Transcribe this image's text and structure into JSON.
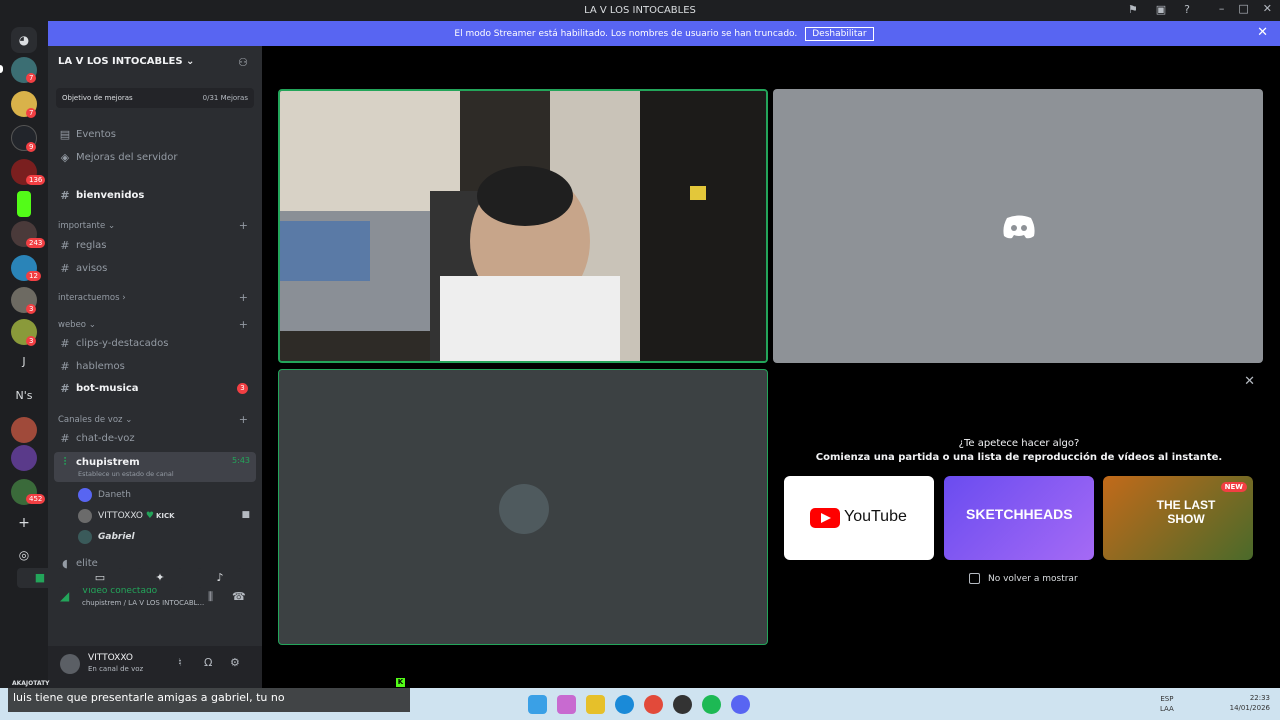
{
  "window": {
    "title": "LA V LOS INTOCABLES"
  },
  "streamer_bar": {
    "text": "El modo Streamer está habilitado. Los nombres de usuario se han truncado.",
    "button": "Deshabilitar"
  },
  "rail": {
    "badges": [
      "7",
      "7",
      "9",
      "136",
      "243",
      "12",
      "3",
      "3",
      "452"
    ],
    "letters": [
      "J",
      "N's"
    ]
  },
  "server": {
    "name": "LA V LOS INTOCABLES",
    "boost_label": "Objetivo de mejoras",
    "boost_progress": "0/31 Mejoras"
  },
  "sidebar": {
    "events": "Eventos",
    "server_boosts": "Mejoras del servidor",
    "ch_bienvenidos": "bienvenidos",
    "cat_importante": "importante",
    "ch_reglas": "reglas",
    "ch_avisos": "avisos",
    "cat_interactuemos": "interactuemos",
    "cat_webeo": "webeo",
    "ch_clips": "clips-y-destacados",
    "ch_hablemos": "hablemos",
    "ch_bot": "bot-musica",
    "bot_badge": "3",
    "cat_voz": "Canales de voz",
    "ch_chat_voz": "chat-de-voz",
    "ch_chupistrem": "chupistrem",
    "chupistrem_time": "5:43",
    "chupistrem_status": "Establece un estado de canal",
    "member_1": "Daneth",
    "member_2": "VITTOXXO",
    "member_2_tag": "KICK",
    "member_3": "Gabriel",
    "ch_elite": "elite"
  },
  "voice": {
    "status": "Vídeo conectado",
    "where": "chupistrem / LA V LOS INTOCABL..."
  },
  "user": {
    "name": "VITTOXXO",
    "status": "En canal de voz"
  },
  "promo": {
    "question": "¿Te apetece hacer algo?",
    "subtitle": "Comienza una partida o una lista de reproducción de vídeos al instante.",
    "activities": [
      "YouTube",
      "SKETCHHEADS",
      "THE LAST SHOW"
    ],
    "new_tag": "NEW",
    "dont_show": "No volver a mostrar"
  },
  "overlay": {
    "chat_name": "AKAJOTATY",
    "chat_message": "luis tiene que presentarle amigas a gabriel, tu no"
  },
  "taskbar": {
    "lang_1": "ESP",
    "lang_2": "LAA",
    "time": "22:33",
    "date": "14/01/2026"
  }
}
